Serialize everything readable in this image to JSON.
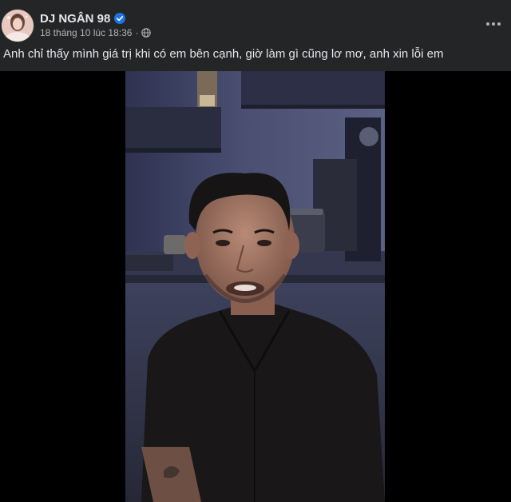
{
  "post": {
    "author": "DJ NGÂN 98",
    "timestamp": "18 tháng 10 lúc 18:36",
    "separator": "·",
    "caption": "Anh chỉ thấy mình giá trị khi có em bên cạnh, giờ làm gì cũng lơ mơ, anh xin lỗi em",
    "audience_icon": "globe-icon",
    "verified_icon": "verified-badge-icon",
    "more_icon": "more-options-icon"
  },
  "colors": {
    "background": "#242526",
    "primary_text": "#e4e6eb",
    "secondary_text": "#b0b3b8",
    "verified_blue": "#1b74e4",
    "media_background": "#000000"
  }
}
